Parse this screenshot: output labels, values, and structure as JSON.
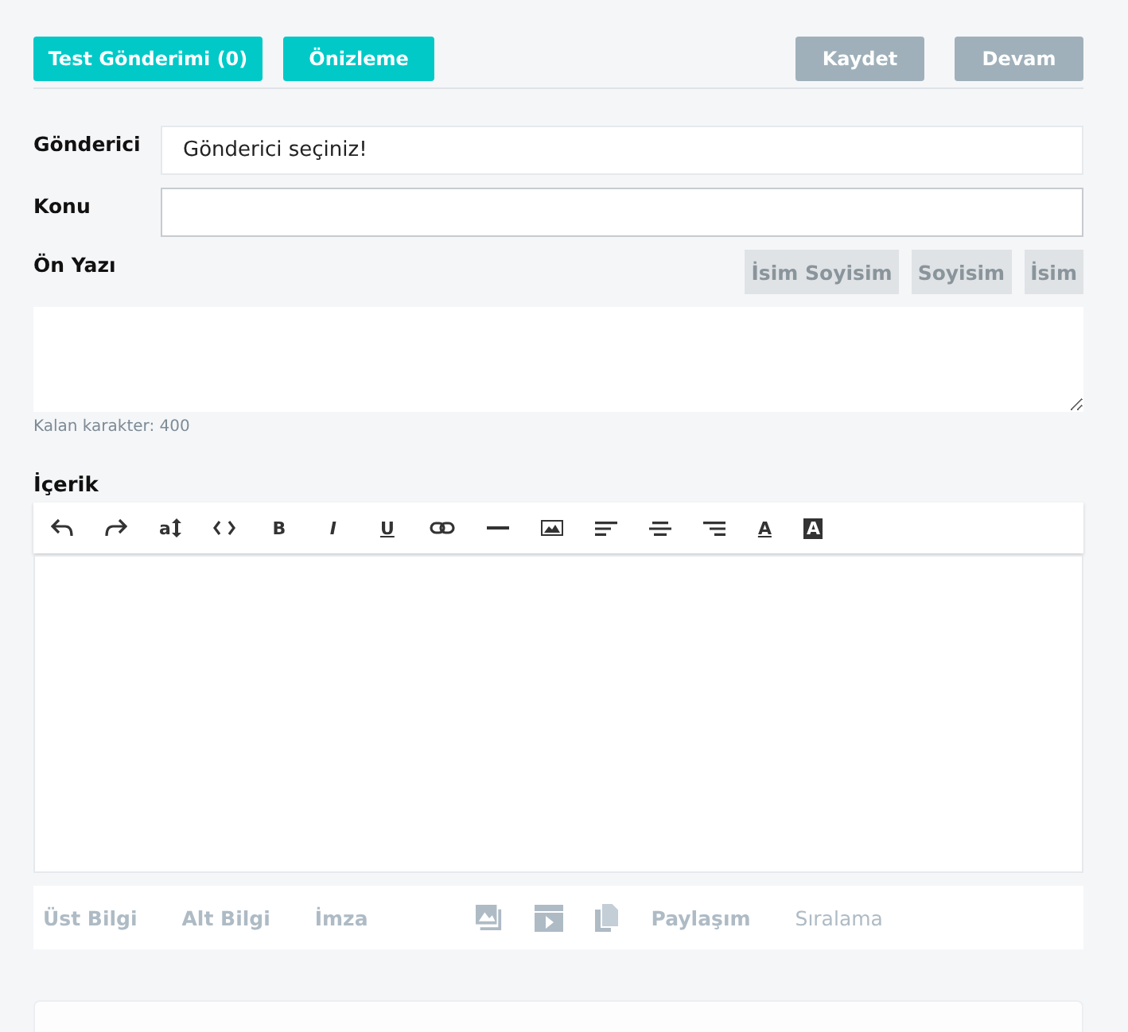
{
  "top_buttons": [
    {
      "label": "Test Gönderimi (0)",
      "disabled": false
    },
    {
      "label": "Önizleme",
      "disabled": false
    },
    {
      "label": "Kaydet",
      "disabled": true
    },
    {
      "label": "Devam",
      "disabled": true
    }
  ],
  "sender": {
    "label": "Gönderici",
    "value": "Gönderici seçiniz!"
  },
  "subject": {
    "label": "Konu"
  },
  "preface": {
    "label": "Ön Yazı",
    "insert_buttons": [
      "İsim Soyisim",
      "Soyisim",
      "İsim"
    ],
    "counter": "Kalan karakter: 400"
  },
  "content": {
    "label": "İçerik",
    "toolbar": [
      {
        "kind": "undo"
      },
      {
        "kind": "redo"
      },
      {
        "kind": "font-size",
        "label": "a"
      },
      {
        "kind": "code"
      },
      {
        "kind": "bold",
        "label": "B"
      },
      {
        "kind": "italic",
        "label": "I"
      },
      {
        "kind": "underline",
        "label": "U"
      },
      {
        "kind": "link"
      },
      {
        "kind": "rule"
      },
      {
        "kind": "image"
      },
      {
        "kind": "align-left"
      },
      {
        "kind": "align-center"
      },
      {
        "kind": "align-right"
      },
      {
        "kind": "text-color",
        "label": "A"
      },
      {
        "kind": "bg-color",
        "label": "A"
      }
    ]
  },
  "bottom_tabs": [
    {
      "kind": "text",
      "label": "Üst Bilgi",
      "bold": true
    },
    {
      "kind": "text",
      "label": "Alt Bilgi",
      "bold": true
    },
    {
      "kind": "text",
      "label": "İmza",
      "bold": true
    },
    {
      "kind": "image"
    },
    {
      "kind": "video"
    },
    {
      "kind": "documents"
    },
    {
      "kind": "text",
      "label": "Paylaşım",
      "bold": true
    },
    {
      "kind": "text",
      "label": "Sıralama",
      "bold": false
    }
  ]
}
